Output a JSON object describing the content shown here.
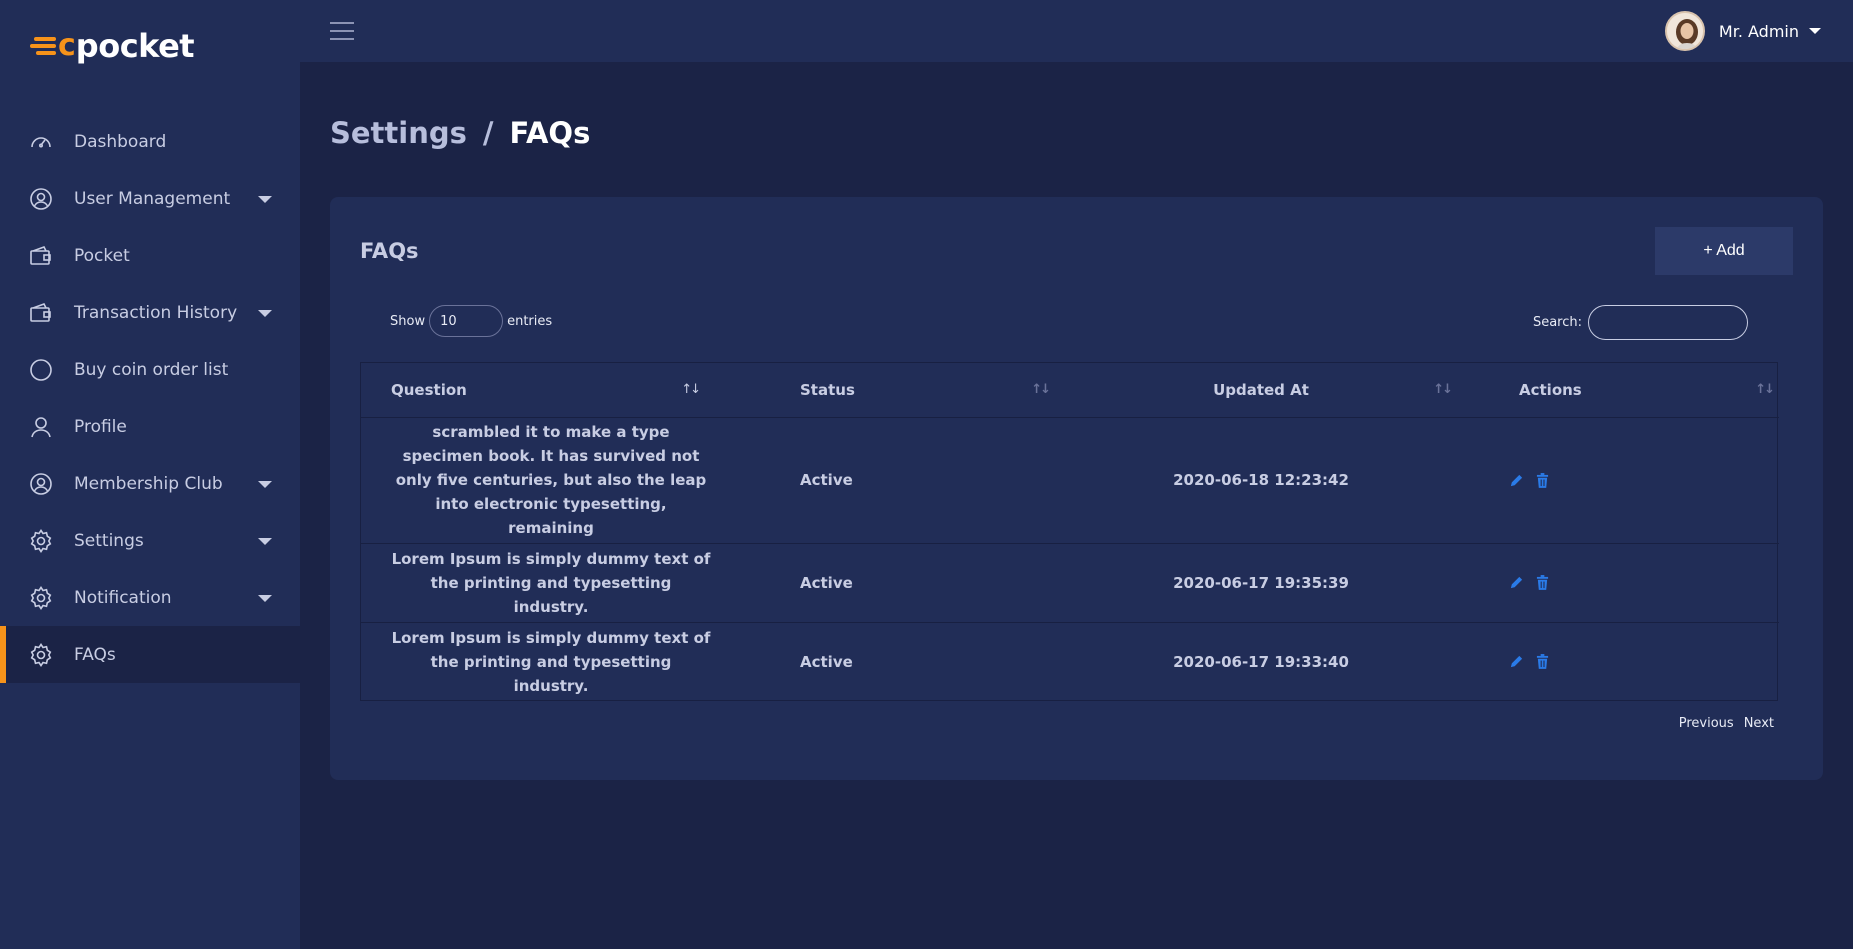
{
  "brand": {
    "mark": "c",
    "name": "pocket"
  },
  "sidebar": {
    "items": [
      {
        "label": "Dashboard",
        "icon": "speedometer-icon",
        "caret": false
      },
      {
        "label": "User Management",
        "icon": "user-circle-icon",
        "caret": true
      },
      {
        "label": "Pocket",
        "icon": "wallet-icon",
        "caret": false
      },
      {
        "label": "Transaction History",
        "icon": "wallet-icon",
        "caret": true
      },
      {
        "label": "Buy coin order list",
        "icon": "circle-icon",
        "caret": false
      },
      {
        "label": "Profile",
        "icon": "user-icon",
        "caret": false
      },
      {
        "label": "Membership Club",
        "icon": "user-circle-icon",
        "caret": true
      },
      {
        "label": "Settings",
        "icon": "gear-icon",
        "caret": true
      },
      {
        "label": "Notification",
        "icon": "gear-icon",
        "caret": true
      },
      {
        "label": "FAQs",
        "icon": "gear-icon",
        "caret": false,
        "active": true
      }
    ]
  },
  "topbar": {
    "user_name": "Mr. Admin"
  },
  "breadcrumb": {
    "parent": "Settings",
    "separator": "/",
    "current": "FAQs"
  },
  "card": {
    "title": "FAQs",
    "add_label": "+ Add",
    "show_label": "Show",
    "entries_value": "10",
    "entries_label": "entries",
    "search_label": "Search:",
    "search_value": ""
  },
  "table": {
    "columns": [
      "Question",
      "Status",
      "Updated At",
      "Actions"
    ],
    "rows": [
      {
        "question": "scrambled it to make a type specimen book. It has survived not only five centuries, but also the leap into electronic typesetting, remaining",
        "status": "Active",
        "updated_at": "2020-06-18 12:23:42"
      },
      {
        "question": "Lorem Ipsum is simply dummy text of the printing and typesetting industry.",
        "status": "Active",
        "updated_at": "2020-06-17 19:35:39"
      },
      {
        "question": "Lorem Ipsum is simply dummy text of the printing and typesetting industry.",
        "status": "Active",
        "updated_at": "2020-06-17 19:33:40"
      }
    ]
  },
  "pagination": {
    "previous": "Previous",
    "next": "Next"
  },
  "colors": {
    "accent": "#f7931a",
    "action": "#2a7be8",
    "sidebar_bg": "#212d57",
    "page_bg": "#1b2346"
  }
}
